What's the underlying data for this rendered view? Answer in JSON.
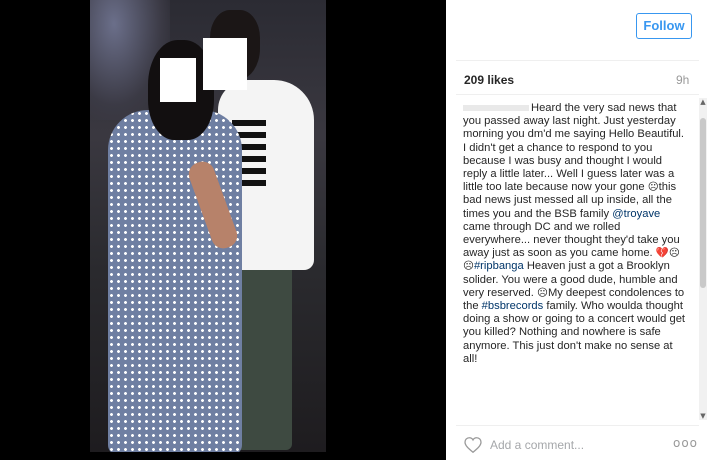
{
  "post": {
    "follow_label": "Follow",
    "likes": "209 likes",
    "time": "9h",
    "caption": {
      "part1": "Heard the very sad news that you passed away last night. Just yesterday morning you dm'd me saying Hello Beautiful. I didn't get a chance to respond to you because I was busy and thought I would reply a little later... Well I guess later was a little too late because now your gone ",
      "emoji1": "☹",
      "part2": "this bad news just messed all up inside, all the times you and the BSB family ",
      "mention_troyave": "@troyave",
      "part3": " came through DC and we rolled everywhere... never thought they'd take you away just as soon as you came home. ",
      "emoji2": "💔☹☹",
      "hashtag_ripbanga": "#ripbanga",
      "part4": " Heaven just a got a Brooklyn solider. You were a good dude, humble and very reserved. ",
      "emoji3": "☹",
      "part5": "My deepest condolences to the ",
      "hashtag_bsbrecords": "#bsbrecords",
      "part6": " family. Who woulda thought doing a show or going to a concert would get you killed? Nothing and nowhere is safe anymore. This just don't make no sense at all!"
    },
    "comment_placeholder": "Add a comment...",
    "more_options": "ooo"
  },
  "icons": {
    "heart": "heart-icon",
    "more": "more-options-icon",
    "scroll_up": "▲",
    "scroll_down": "▼"
  },
  "colors": {
    "accent": "#3897f0",
    "link": "#003569",
    "text": "#262626",
    "muted": "#999999"
  }
}
